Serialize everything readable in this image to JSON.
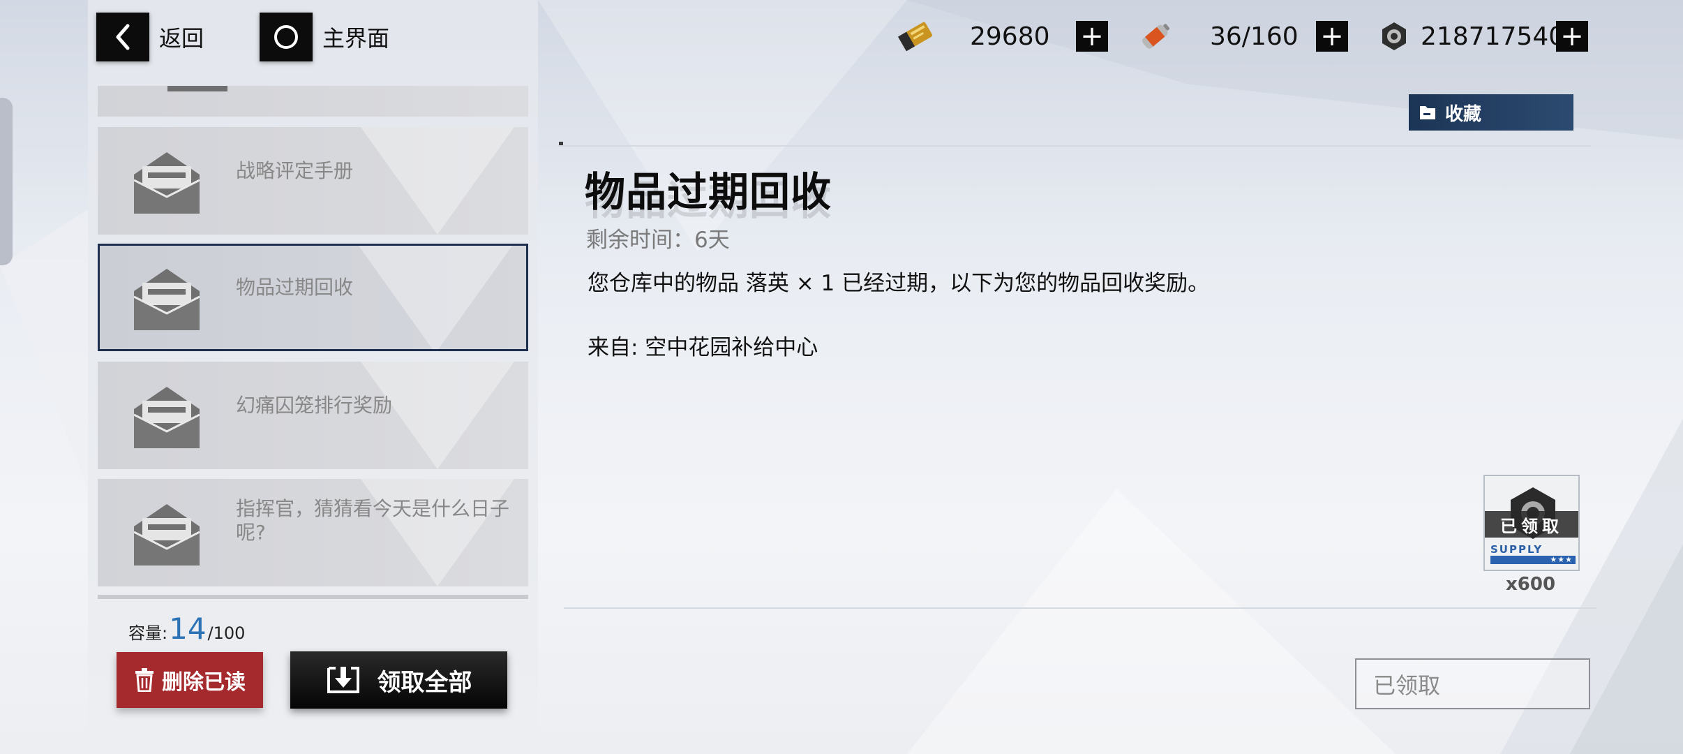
{
  "nav": {
    "back_label": "返回",
    "home_label": "主界面"
  },
  "currencies": [
    {
      "icon": "ticket-icon",
      "value": "29680"
    },
    {
      "icon": "battery-icon",
      "value": "36/160"
    },
    {
      "icon": "gear-nut-icon",
      "value": "218717540"
    }
  ],
  "mail_list": {
    "items": [
      {
        "title": "战略评定手册",
        "selected": false
      },
      {
        "title": "物品过期回收",
        "selected": true
      },
      {
        "title": "幻痛囚笼排行奖励",
        "selected": false
      },
      {
        "title": "指挥官，猜猜看今天是什么日子呢?",
        "selected": false
      }
    ],
    "capacity_label": "容量:",
    "capacity_count": "14",
    "capacity_max": "/100",
    "delete_read_label": "删除已读",
    "claim_all_label": "领取全部"
  },
  "mail": {
    "favorite_label": "收藏",
    "title": "物品过期回收",
    "remaining": "剩余时间：6天",
    "body": "您仓库中的物品 落英 × 1 已经过期，以下为您的物品回收奖励。",
    "from": "来自: 空中花园补给中心",
    "reward": {
      "icon": "gear-nut-icon",
      "claimed_badge": "已领取",
      "supply_label": "SUPPLY",
      "stars": "★★★",
      "quantity": "x600"
    },
    "claimed_button_label": "已领取"
  },
  "colors": {
    "accent_red": "#a52a2e",
    "selected_border": "#1d2f4c",
    "capacity_blue": "#2b73b6",
    "favorite_blue": "#1c3556"
  }
}
